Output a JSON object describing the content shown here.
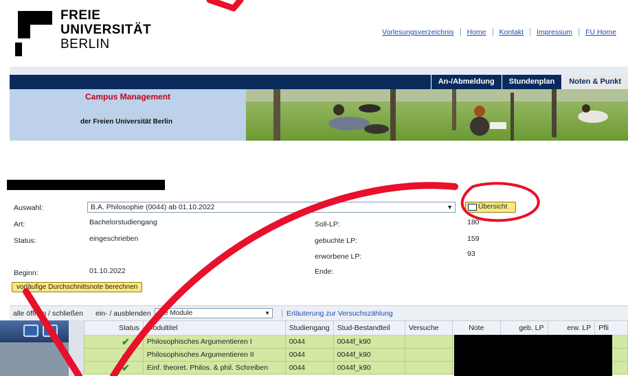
{
  "header": {
    "logo": {
      "line1": "FREIE",
      "line2": "UNIVERSITÄT",
      "line3": "BERLIN"
    },
    "links": [
      "Vorlesungsverzeichnis",
      "Home",
      "Kontakt",
      "Impressum",
      "FU Home"
    ]
  },
  "nav": {
    "tabs": [
      "An-/Abmeldung",
      "Stundenplan",
      "Noten & Punkt"
    ]
  },
  "banner": {
    "title": "Campus Management",
    "subtitle": "der Freien Universität Berlin"
  },
  "info": {
    "auswahl_label": "Auswahl:",
    "auswahl_value": "B.A. Philosophie (0044) ab 01.10.2022",
    "uebersicht_button": "Übersicht",
    "art_label": "Art:",
    "art_value": "Bachelorstudiengang",
    "status_label": "Status:",
    "status_value": "eingeschrieben",
    "beginn_label": "Beginn:",
    "beginn_value": "01.10.2022",
    "soll_label": "Soll-LP:",
    "soll_value": "180",
    "gebucht_label": "gebuchte LP:",
    "gebucht_value": "159",
    "erworben_label": "erworbene LP:",
    "erworben_value": "93",
    "ende_label": "Ende:",
    "durchschnitt_button": "vorläufige Durchschnittsnote berechnen"
  },
  "filter": {
    "toggle_all": "alle öffnen / schließen",
    "toggle_partial": "ein- / ausblenden",
    "module_select": "alle Module",
    "explanation_link": "Erläuterung zur Versuchszählung"
  },
  "table": {
    "headers": [
      "Status",
      "Modultitel",
      "Studiengang",
      "Stud-Bestandteil",
      "Versuche",
      "Note",
      "geb. LP",
      "erw. LP",
      "Pfli"
    ],
    "rows": [
      {
        "status": "✔",
        "modultitel": "Philosophisches Argumentieren I",
        "studiengang": "0044",
        "bestandteil": "0044f_k90"
      },
      {
        "status": "✔",
        "modultitel": "Philosophisches Argumentieren II",
        "studiengang": "0044",
        "bestandteil": "0044f_k90"
      },
      {
        "status": "✔",
        "modultitel": "Einf. theoret. Philos. & phil. Schreiben",
        "studiengang": "0044",
        "bestandteil": "0044f_k90"
      }
    ]
  },
  "colors": {
    "nav_bg": "#0a2a5c",
    "banner_bg": "#bdd2ea",
    "title_red": "#c0001a",
    "row_green": "#d2e8a3",
    "annotation_red": "#e8102a"
  }
}
